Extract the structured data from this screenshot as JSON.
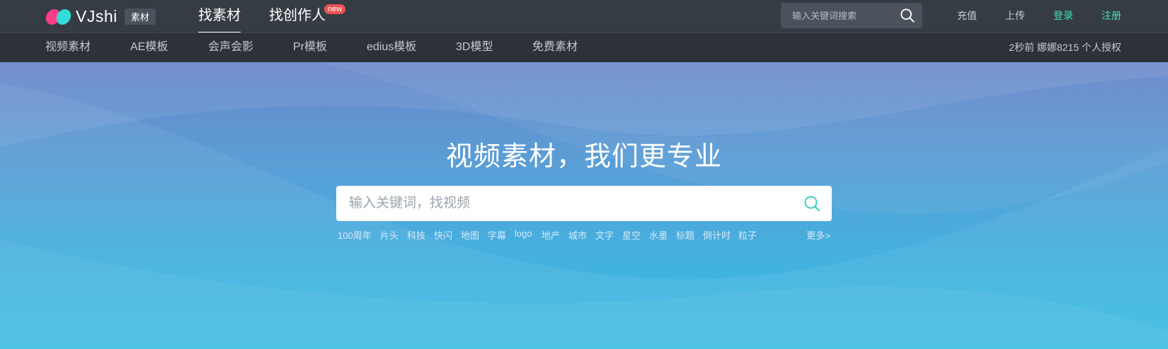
{
  "logo": {
    "text": "VJshi",
    "badge": "素材"
  },
  "nav": {
    "find_material": "找素材",
    "find_creator": "找创作人",
    "new_badge": "new"
  },
  "top_search": {
    "placeholder": "输入关键词搜索"
  },
  "top_links": {
    "recharge": "充值",
    "upload": "上传",
    "login": "登录",
    "register": "注册"
  },
  "subnav": {
    "items": [
      "视频素材",
      "AE模板",
      "会声会影",
      "Pr模板",
      "edius模板",
      "3D模型",
      "免费素材"
    ],
    "notice": "2秒前 娜娜8215 个人授权"
  },
  "hero": {
    "title": "视频素材，我们更专业",
    "search_placeholder": "输入关键词，找视频",
    "tags": [
      "100周年",
      "片头",
      "科技",
      "快闪",
      "地图",
      "字幕",
      "logo",
      "地产",
      "城市",
      "文字",
      "星空",
      "水墨",
      "标题",
      "倒计时",
      "粒子"
    ],
    "more": "更多>"
  },
  "colors": {
    "topbar": "#363c44",
    "subbar": "#2d3238",
    "accent_green": "#3ee0b4",
    "new_badge": "#e75252"
  }
}
